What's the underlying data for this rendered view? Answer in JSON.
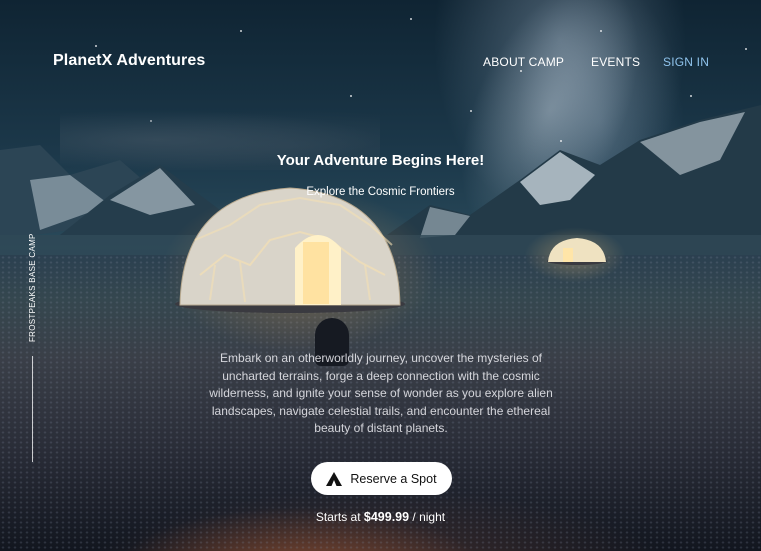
{
  "nav": {
    "brand": "PlanetX Adventures",
    "links": [
      "ABOUT CAMP",
      "EVENTS",
      "SIGN IN"
    ]
  },
  "hero": {
    "title": "Your Adventure Begins Here!",
    "subtitle": "Explore the Cosmic Frontiers",
    "side_label": "FROSTPEAKS BASE CAMP",
    "description": "Embark on an otherworldly journey, uncover the mysteries of uncharted terrains, forge a deep connection with the cosmic wilderness, and ignite your sense of wonder as you explore alien landscapes, navigate celestial trails, and encounter the ethereal beauty of distant planets.",
    "cta": {
      "label": "Reserve a Spot",
      "icon": "triangle-tent-icon"
    },
    "price": {
      "prefix": "Starts at",
      "amount": "$499.99",
      "suffix": "/ night"
    }
  },
  "colors": {
    "accent_link": "#8fc3ec",
    "button_bg": "#ffffff",
    "text": "#ffffff"
  }
}
